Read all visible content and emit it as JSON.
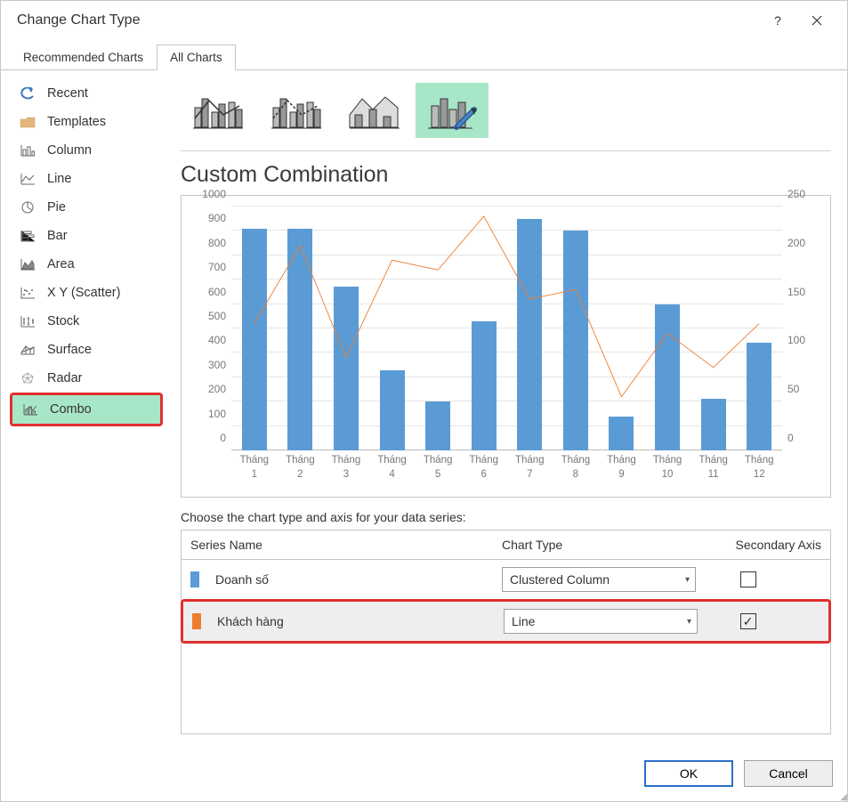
{
  "dialog": {
    "title": "Change Chart Type"
  },
  "tabs": {
    "recommended": "Recommended Charts",
    "all": "All Charts"
  },
  "sidebar": {
    "items": [
      {
        "label": "Recent"
      },
      {
        "label": "Templates"
      },
      {
        "label": "Column"
      },
      {
        "label": "Line"
      },
      {
        "label": "Pie"
      },
      {
        "label": "Bar"
      },
      {
        "label": "Area"
      },
      {
        "label": "X Y (Scatter)"
      },
      {
        "label": "Stock"
      },
      {
        "label": "Surface"
      },
      {
        "label": "Radar"
      },
      {
        "label": "Combo"
      }
    ]
  },
  "main_title": "Custom Combination",
  "series_help": "Choose the chart type and axis for your data series:",
  "series_table": {
    "headers": {
      "name": "Series Name",
      "type": "Chart Type",
      "axis": "Secondary Axis"
    },
    "rows": [
      {
        "swatch": "#5b9bd5",
        "name": "Doanh số",
        "chart_type": "Clustered Column",
        "secondary": false
      },
      {
        "swatch": "#ed7d31",
        "name": "Khách hàng",
        "chart_type": "Line",
        "secondary": true
      }
    ]
  },
  "footer": {
    "ok": "OK",
    "cancel": "Cancel"
  },
  "chart_data": {
    "type": "combo",
    "categories": [
      "Tháng 1",
      "Tháng 2",
      "Tháng 3",
      "Tháng 4",
      "Tháng 5",
      "Tháng 6",
      "Tháng 7",
      "Tháng 8",
      "Tháng 9",
      "Tháng 10",
      "Tháng 11",
      "Tháng 12"
    ],
    "series": [
      {
        "name": "Doanh số",
        "type": "bar",
        "axis": "primary",
        "values": [
          910,
          910,
          670,
          330,
          200,
          530,
          950,
          900,
          140,
          600,
          210,
          440
        ]
      },
      {
        "name": "Khách hàng",
        "type": "line",
        "axis": "secondary",
        "values": [
          130,
          210,
          95,
          195,
          185,
          240,
          155,
          165,
          55,
          120,
          85,
          130
        ]
      }
    ],
    "primary_axis": {
      "min": 0,
      "max": 1000,
      "step": 100
    },
    "secondary_axis": {
      "min": 0,
      "max": 250,
      "step": 50
    }
  }
}
